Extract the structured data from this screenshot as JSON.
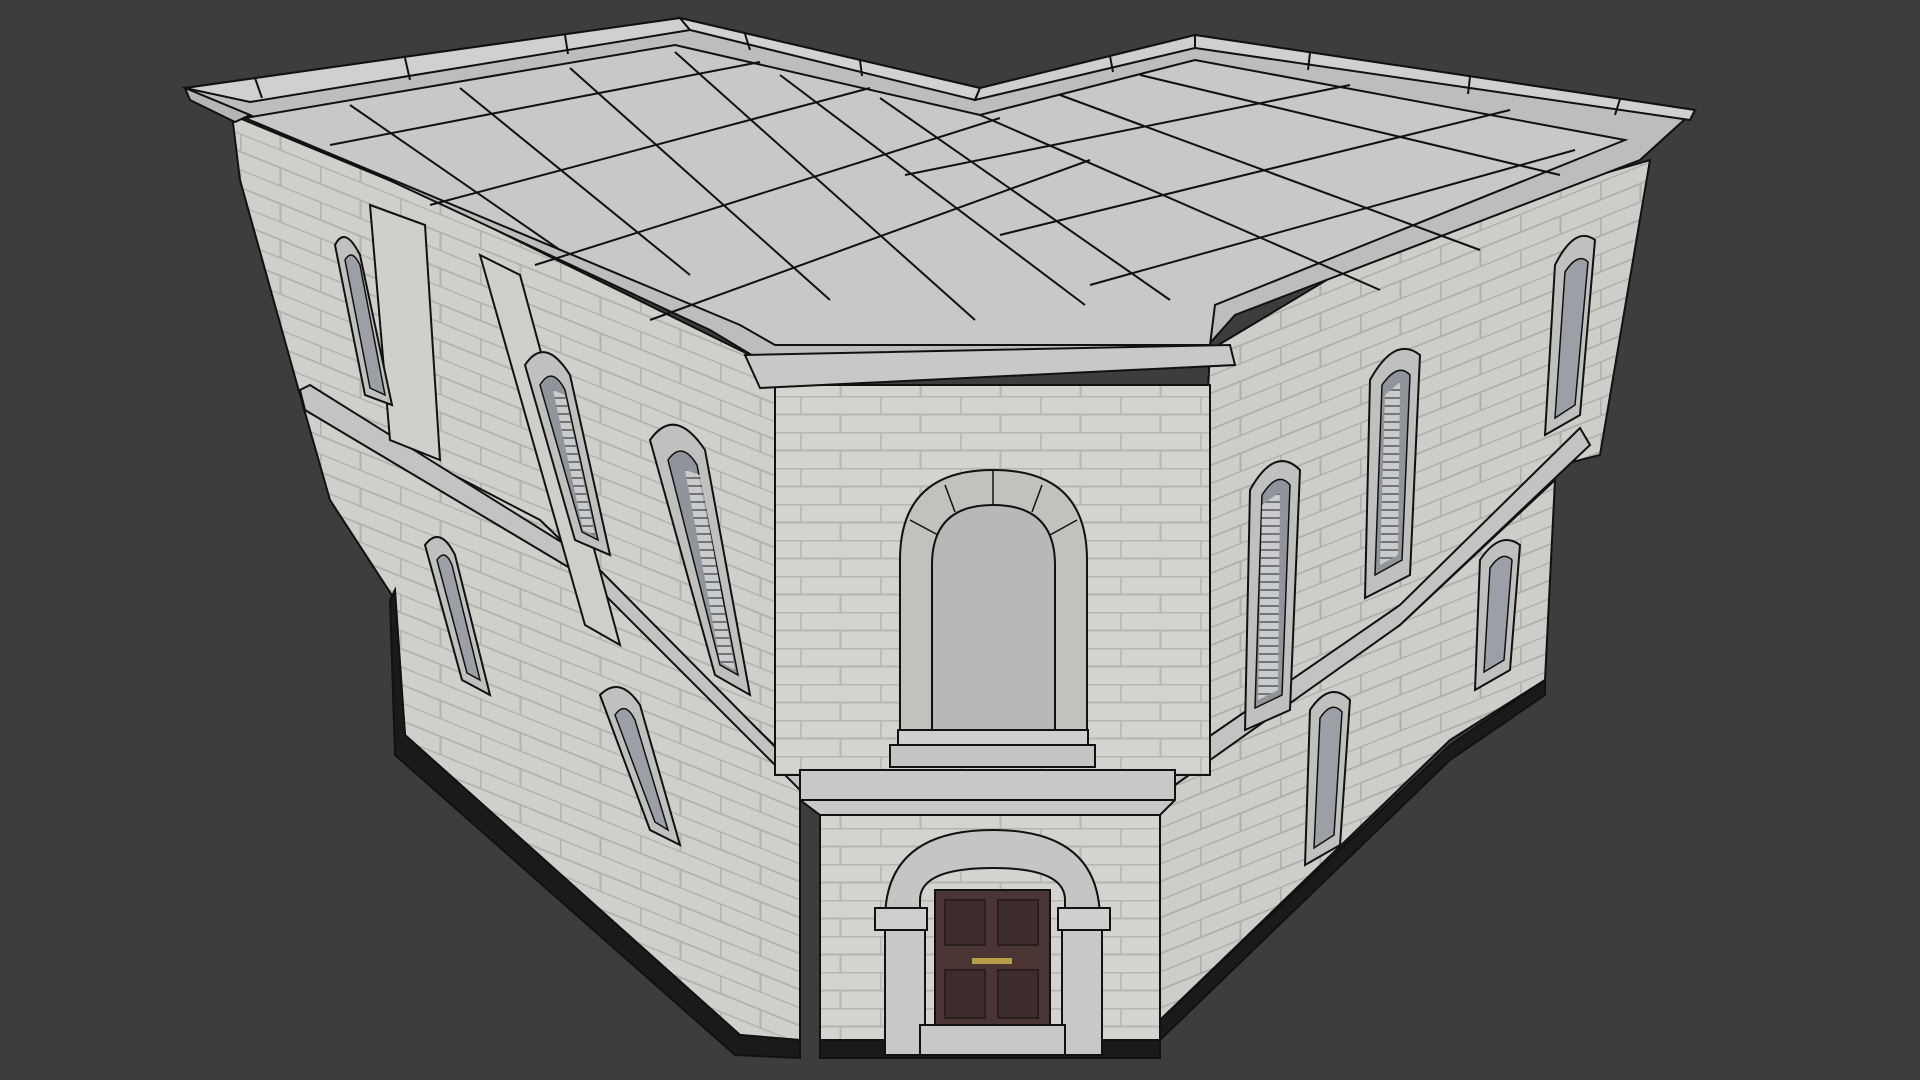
{
  "viewport": {
    "background": "#3d3d3d"
  },
  "model": {
    "wall_color": "#d4d3cf",
    "mortar_color": "#b9b8b3",
    "trim_color": "#c7c7c5",
    "roof_color": "#c8c8c6",
    "outline_color": "#111111",
    "plinth_color": "#1a1a1a",
    "door_color": "#4a3434",
    "glass_color": "#8e9196",
    "mail_slot_color": "#b89d48"
  }
}
